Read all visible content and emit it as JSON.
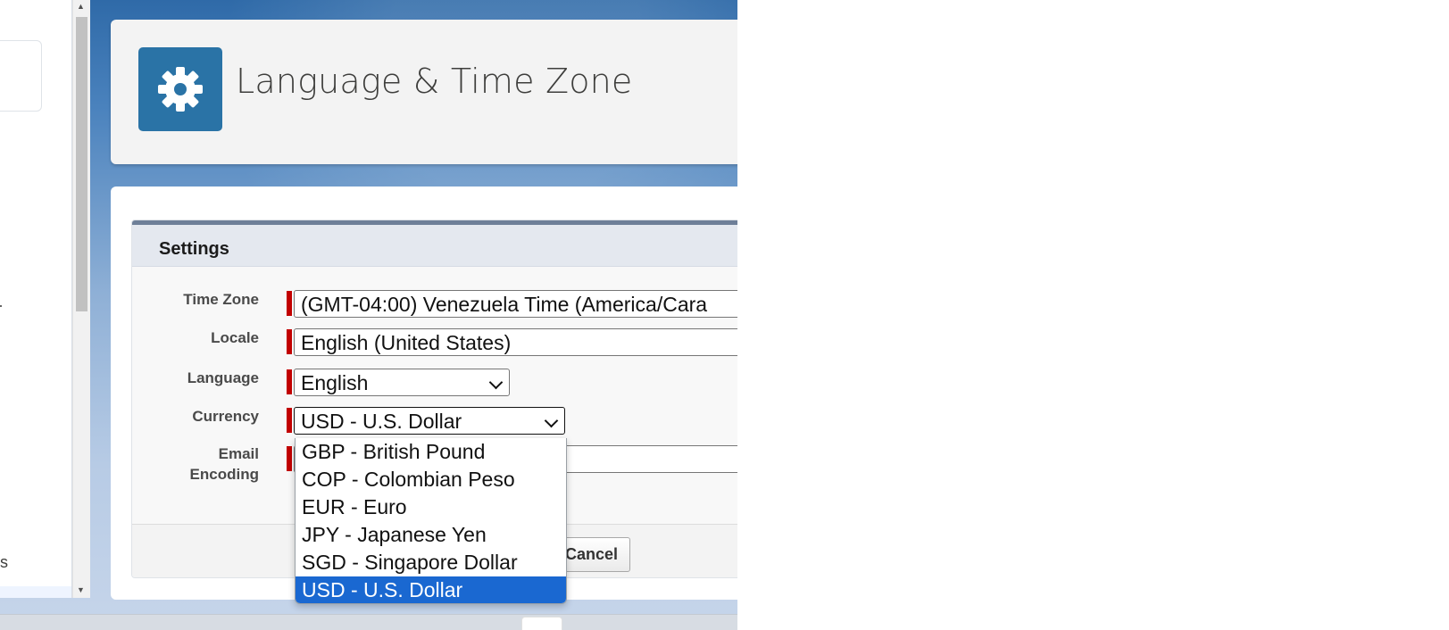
{
  "page": {
    "title": "Language & Time Zone",
    "icon": "gear-icon"
  },
  "left_panel": {
    "partial_text": "s"
  },
  "section": {
    "title": "Settings"
  },
  "fields": {
    "time_zone": {
      "label": "Time Zone",
      "value": "(GMT-04:00) Venezuela Time (America/Cara"
    },
    "locale": {
      "label": "Locale",
      "value": "English (United States)"
    },
    "language": {
      "label": "Language",
      "value": "English"
    },
    "currency": {
      "label": "Currency",
      "value": "USD - U.S. Dollar"
    },
    "email_encoding": {
      "label_line1": "Email",
      "label_line2": "Encoding"
    }
  },
  "buttons": {
    "cancel": "Cancel"
  },
  "currency_dropdown": {
    "options": [
      "GBP - British Pound",
      "COP - Colombian Peso",
      "EUR - Euro",
      "JPY - Japanese Yen",
      "SGD - Singapore Dollar",
      "USD - U.S. Dollar"
    ],
    "selected_index": 5
  },
  "colors": {
    "accent": "#2a73a6",
    "required": "#c20000",
    "selected_option": "#1a68d1"
  }
}
